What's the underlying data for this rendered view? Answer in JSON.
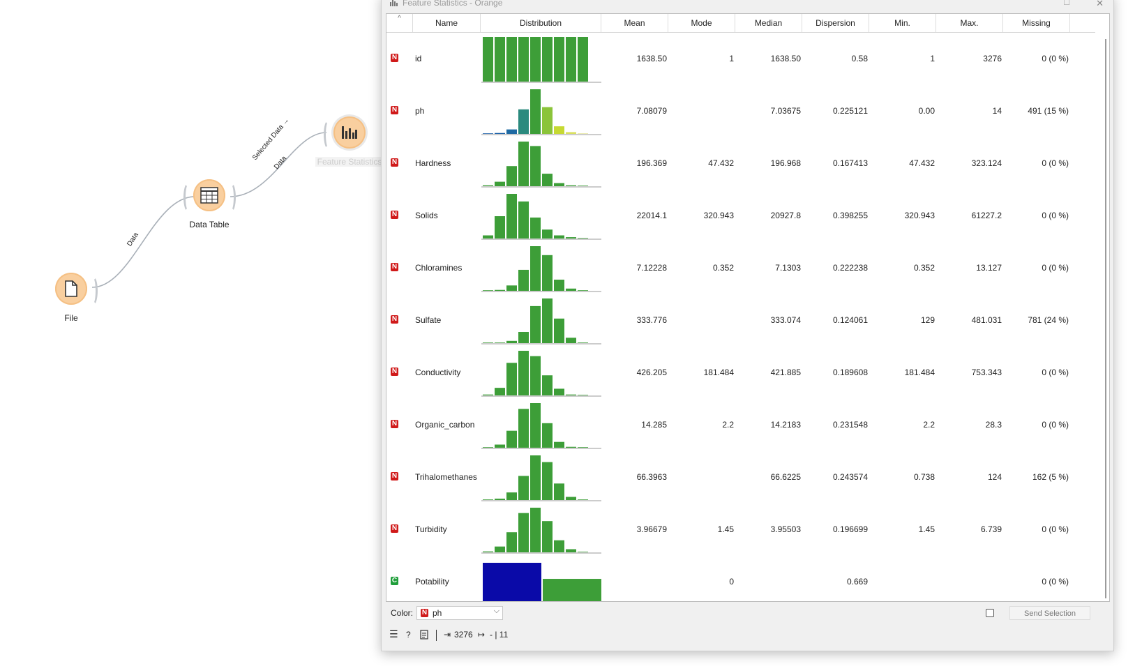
{
  "canvas": {
    "nodes": [
      {
        "label": "File",
        "icon": "file-icon"
      },
      {
        "label": "Data Table",
        "icon": "table-icon"
      },
      {
        "label": "Feature Statistics",
        "icon": "bar-chart-icon"
      }
    ],
    "links": [
      {
        "label": "Data"
      },
      {
        "label": "Selected Data →"
      },
      {
        "label": "Data"
      }
    ]
  },
  "window": {
    "title": "Feature Statistics - Orange",
    "columns": [
      "Name",
      "Distribution",
      "Mean",
      "Mode",
      "Median",
      "Dispersion",
      "Min.",
      "Max.",
      "Missing"
    ],
    "rows": [
      {
        "type": "N",
        "name": "id",
        "mean": "1638.50",
        "mode": "1",
        "median": "1638.50",
        "dispersion": "0.58",
        "min": "1",
        "max": "3276",
        "missing": "0 (0 %)",
        "hist": [
          1,
          1,
          1,
          1,
          1,
          1,
          1,
          1,
          1
        ],
        "colors": "green"
      },
      {
        "type": "N",
        "name": "ph",
        "mean": "7.08079",
        "mode": "",
        "median": "7.03675",
        "dispersion": "0.225121",
        "min": "0.00",
        "max": "14",
        "missing": "491 (15 %)",
        "hist": [
          0.01,
          0.02,
          0.1,
          0.55,
          1,
          0.6,
          0.17,
          0.04,
          0
        ],
        "colors": "ph"
      },
      {
        "type": "N",
        "name": "Hardness",
        "mean": "196.369",
        "mode": "47.432",
        "median": "196.968",
        "dispersion": "0.167413",
        "min": "47.432",
        "max": "323.124",
        "missing": "0 (0 %)",
        "hist": [
          0.02,
          0.1,
          0.45,
          1,
          0.9,
          0.28,
          0.07,
          0.02,
          0
        ],
        "colors": "green"
      },
      {
        "type": "N",
        "name": "Solids",
        "mean": "22014.1",
        "mode": "320.943",
        "median": "20927.8",
        "dispersion": "0.398255",
        "min": "320.943",
        "max": "61227.2",
        "missing": "0 (0 %)",
        "hist": [
          0.07,
          0.5,
          1,
          0.83,
          0.47,
          0.2,
          0.07,
          0.03,
          0
        ],
        "colors": "green"
      },
      {
        "type": "N",
        "name": "Chloramines",
        "mean": "7.12228",
        "mode": "0.352",
        "median": "7.1303",
        "dispersion": "0.222238",
        "min": "0.352",
        "max": "13.127",
        "missing": "0 (0 %)",
        "hist": [
          0,
          0.02,
          0.12,
          0.47,
          1,
          0.8,
          0.25,
          0.05,
          0.01
        ],
        "colors": "green"
      },
      {
        "type": "N",
        "name": "Sulfate",
        "mean": "333.776",
        "mode": "",
        "median": "333.074",
        "dispersion": "0.124061",
        "min": "129",
        "max": "481.031",
        "missing": "781 (24 %)",
        "hist": [
          0,
          0.01,
          0.05,
          0.25,
          0.83,
          1,
          0.55,
          0.12,
          0.01
        ],
        "colors": "green"
      },
      {
        "type": "N",
        "name": "Conductivity",
        "mean": "426.205",
        "mode": "181.484",
        "median": "421.885",
        "dispersion": "0.189608",
        "min": "181.484",
        "max": "753.343",
        "missing": "0 (0 %)",
        "hist": [
          0.02,
          0.17,
          0.73,
          1,
          0.88,
          0.45,
          0.15,
          0.02,
          0
        ],
        "colors": "green"
      },
      {
        "type": "N",
        "name": "Organic_carbon",
        "mean": "14.285",
        "mode": "2.2",
        "median": "14.2183",
        "dispersion": "0.231548",
        "min": "2.2",
        "max": "28.3",
        "missing": "0 (0 %)",
        "hist": [
          0.01,
          0.07,
          0.38,
          0.87,
          1,
          0.55,
          0.13,
          0.02,
          0
        ],
        "colors": "green"
      },
      {
        "type": "N",
        "name": "Trihalomethanes",
        "mean": "66.3963",
        "mode": "",
        "median": "66.6225",
        "dispersion": "0.243574",
        "min": "0.738",
        "max": "124",
        "missing": "162 (5 %)",
        "hist": [
          0,
          0.03,
          0.17,
          0.54,
          1,
          0.85,
          0.37,
          0.07,
          0.01
        ],
        "colors": "green"
      },
      {
        "type": "N",
        "name": "Turbidity",
        "mean": "3.96679",
        "mode": "1.45",
        "median": "3.95503",
        "dispersion": "0.196699",
        "min": "1.45",
        "max": "6.739",
        "missing": "0 (0 %)",
        "hist": [
          0.02,
          0.13,
          0.45,
          0.88,
          1,
          0.7,
          0.27,
          0.07,
          0.01
        ],
        "colors": "green"
      },
      {
        "type": "C",
        "name": "Potability",
        "mean": "",
        "mode": "0",
        "median": "",
        "dispersion": "0.669",
        "min": "",
        "max": "",
        "missing": "0 (0 %)",
        "hist": [
          1,
          0.64
        ],
        "colors": "potability"
      }
    ]
  },
  "bottom": {
    "color_label": "Color:",
    "color_value": "ph",
    "color_badge": "N",
    "send_label": "Send Selection",
    "status_in": "3276",
    "status_out": "- | 11"
  },
  "colors": {
    "bar_green": "#3d9e38",
    "potability_blue": "#0a0aa8",
    "node_orange": "#f9cf9f"
  }
}
